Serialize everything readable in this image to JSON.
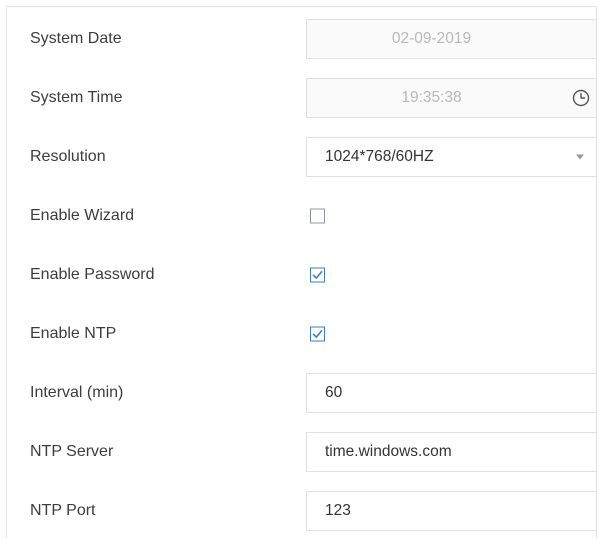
{
  "settings": {
    "system_date": {
      "label": "System Date",
      "value": "02-09-2019"
    },
    "system_time": {
      "label": "System Time",
      "value": "19:35:38",
      "icon": "clock-icon"
    },
    "resolution": {
      "label": "Resolution",
      "value": "1024*768/60HZ",
      "icon": "chevron-down-icon"
    },
    "enable_wizard": {
      "label": "Enable Wizard",
      "checked": false
    },
    "enable_password": {
      "label": "Enable Password",
      "checked": true
    },
    "enable_ntp": {
      "label": "Enable NTP",
      "checked": true
    },
    "interval": {
      "label": "Interval (min)",
      "value": "60"
    },
    "ntp_server": {
      "label": "NTP Server",
      "value": "time.windows.com"
    },
    "ntp_port": {
      "label": "NTP Port",
      "value": "123"
    }
  },
  "colors": {
    "check_accent": "#3c7ec0",
    "disabled_text": "#b8b8b8",
    "border": "#e0e0e0"
  }
}
